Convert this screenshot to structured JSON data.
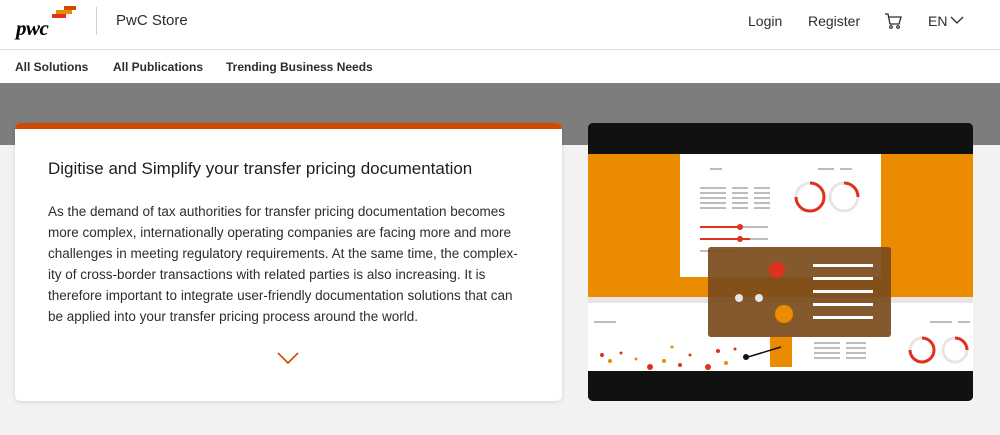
{
  "header": {
    "logo_text": "pwc",
    "store_title": "PwC Store",
    "login_label": "Login",
    "register_label": "Register",
    "cart_icon": "cart-icon",
    "language_label": "EN"
  },
  "nav": {
    "items": [
      {
        "label": "All Solutions"
      },
      {
        "label": "All Publications"
      },
      {
        "label": "Trending Business Needs"
      }
    ]
  },
  "hero": {
    "title": "Digitise and Simplify your transfer pricing documentation",
    "body": "As the demand of tax authorities for transfer pricing documentation becomes more complex, internationally operating companies are facing more and more challenges in meeting regulatory requirements. At the same time, the complex-ity of cross-border transactions with related parties is also increasing. It is therefore important to integrate user-friendly documentation solutions that can be applied into your transfer pricing process around the world."
  },
  "colors": {
    "brand_orange": "#d04a02",
    "video_orange": "#eb8c00",
    "accent_red": "#e0301e",
    "hero_grey": "#7d7d7d"
  }
}
